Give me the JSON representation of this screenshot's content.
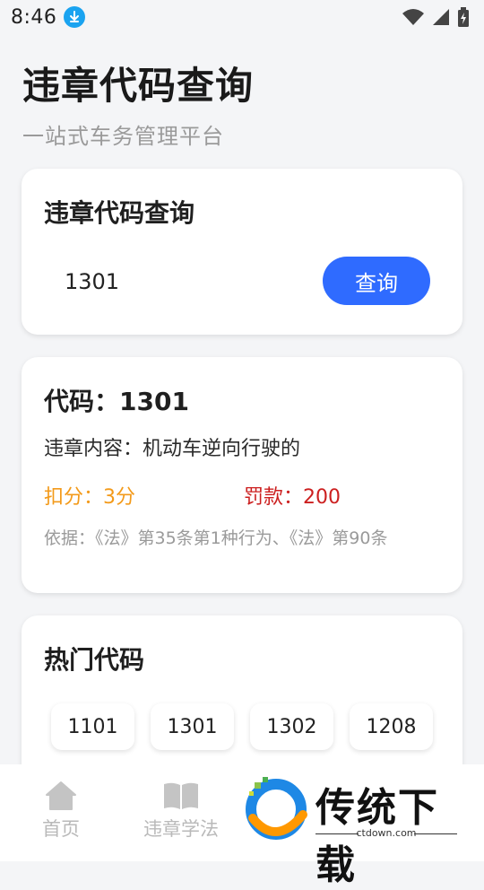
{
  "status": {
    "time": "8:46",
    "icons": [
      "download-icon",
      "wifi-icon",
      "signal-icon",
      "battery-icon"
    ]
  },
  "header": {
    "title": "违章代码查询",
    "subtitle": "一站式车务管理平台"
  },
  "query_card": {
    "title": "违章代码查询",
    "input_value": "1301",
    "button_label": "查询"
  },
  "result_card": {
    "code_line": "代码：1301",
    "content_line": "违章内容：机动车逆向行驶的",
    "points_line": "扣分：3分",
    "fine_line": "罚款：200",
    "basis_line": "依据：《法》第35条第1种行为、《法》第90条"
  },
  "hot_card": {
    "title": "热门代码",
    "codes": [
      "1101",
      "1301",
      "1302",
      "1208"
    ]
  },
  "bottom_nav": {
    "items": [
      {
        "label": "首页",
        "icon": "home-icon"
      },
      {
        "label": "违章学法",
        "icon": "book-icon"
      }
    ]
  },
  "watermark": {
    "text": "传统下载",
    "domain": "ctdown.com"
  },
  "colors": {
    "accent": "#2f6bff",
    "points": "#f39a1a",
    "fine": "#cc1f1f",
    "muted": "#9a9a9a",
    "background": "#f4f5f7"
  }
}
